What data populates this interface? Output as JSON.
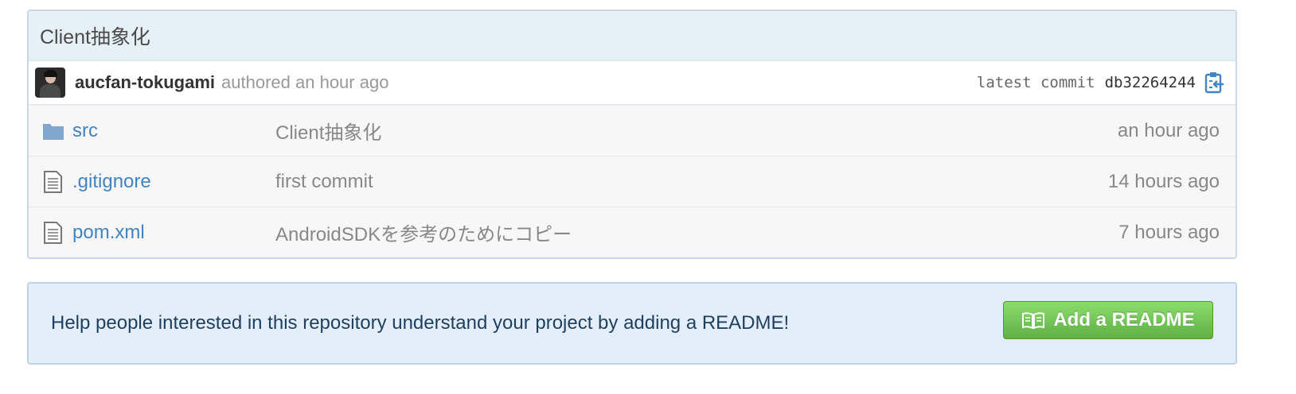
{
  "commit": {
    "title": "Client抽象化",
    "author": "aucfan-tokugami",
    "authored_text": "authored an hour ago",
    "latest_label": "latest commit",
    "sha": "db32264244"
  },
  "files": [
    {
      "name": "src",
      "type": "folder",
      "message": "Client抽象化",
      "age": "an hour ago"
    },
    {
      "name": ".gitignore",
      "type": "file",
      "message": "first commit",
      "age": "14 hours ago"
    },
    {
      "name": "pom.xml",
      "type": "file",
      "message": "AndroidSDKを参考のためにコピー",
      "age": "7 hours ago"
    }
  ],
  "readme": {
    "prompt": "Help people interested in this repository understand your project by adding a README!",
    "button_label": "Add a README"
  },
  "icons": {
    "folder": "folder-icon",
    "file": "file-icon",
    "clipboard": "clipboard-icon",
    "book": "book-icon"
  },
  "colors": {
    "link": "#4183c4",
    "header_bg": "#e5f0f7",
    "readme_bg": "#e3eefa",
    "button_green": "#60b044"
  }
}
